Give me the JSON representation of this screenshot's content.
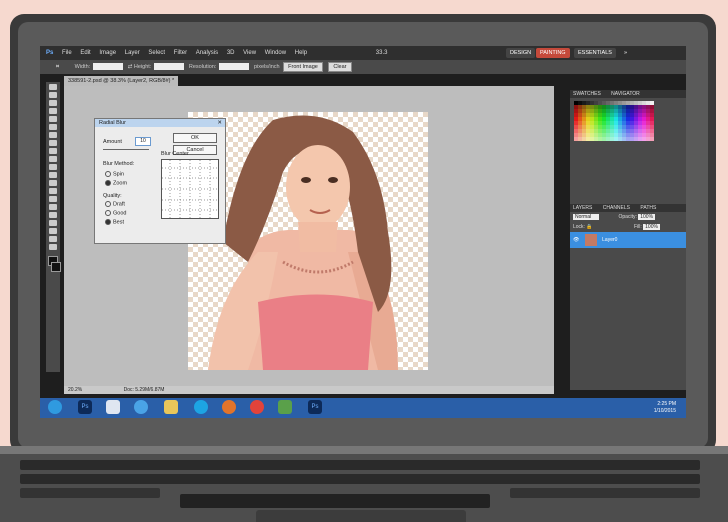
{
  "menu": {
    "logo": "Ps",
    "items": [
      "File",
      "Edit",
      "Image",
      "Layer",
      "Select",
      "Filter",
      "Analysis",
      "3D",
      "View",
      "Window",
      "Help"
    ],
    "zoom": "33.3",
    "workspaces": [
      "DESIGN",
      "PAINTING",
      "ESSENTIALS"
    ],
    "more": "»"
  },
  "options": {
    "width_label": "Width:",
    "height_label": "Height:",
    "resolution_label": "Resolution:",
    "resolution_unit": "pixels/inch",
    "front_image": "Front Image",
    "clear": "Clear"
  },
  "document": {
    "tab": "338591-2.psd @ 38.3% (Layer2, RGB/8#) *",
    "zoom_status": "20.2%",
    "doc_info": "Doc: 5.29M/6.87M"
  },
  "dialog": {
    "title": "Radial Blur",
    "amount_label": "Amount",
    "amount_value": "10",
    "ok": "OK",
    "cancel": "Cancel",
    "blur_method_label": "Blur Method:",
    "methods": [
      "Spin",
      "Zoom"
    ],
    "selected_method": "Zoom",
    "quality_label": "Quality:",
    "qualities": [
      "Draft",
      "Good",
      "Best"
    ],
    "selected_quality": "Best",
    "blur_center_label": "Blur Center"
  },
  "panels": {
    "swatch_tabs": [
      "SWATCHES",
      "NAVIGATOR"
    ],
    "layer_tabs": [
      "LAYERS",
      "CHANNELS",
      "PATHS"
    ],
    "blend_mode": "Normal",
    "opacity_label": "Opacity:",
    "opacity_value": "100%",
    "lock_label": "Lock:",
    "fill_label": "Fill:",
    "fill_value": "100%",
    "layer_name": "Layer0"
  },
  "taskbar": {
    "time": "2:25 PM",
    "date": "1/10/2015"
  },
  "colors": {
    "accent": "#3b8fe0",
    "workspace_active": "#c54a3b",
    "taskbar": "#2a5fa8"
  }
}
